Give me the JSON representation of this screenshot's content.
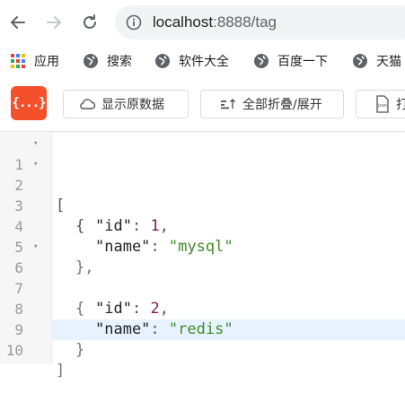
{
  "browser": {
    "url_host": "localhost",
    "url_port": ":8888",
    "url_path": "/tag"
  },
  "bookmarks": [
    {
      "label": "应用",
      "icon": "apps-grid-icon"
    },
    {
      "label": "搜索",
      "icon": "globe-icon"
    },
    {
      "label": "软件大全",
      "icon": "globe-icon"
    },
    {
      "label": "百度一下",
      "icon": "globe-icon"
    },
    {
      "label": "天猫",
      "icon": "globe-icon"
    }
  ],
  "toolbar": {
    "logo_text": "{...}",
    "raw_label": "显示原数据",
    "collapse_label": "全部折叠/展开",
    "print_label": "打"
  },
  "code": {
    "lines": [
      {
        "n": "1",
        "fold": "▾"
      },
      {
        "n": "2",
        "fold": "▾"
      },
      {
        "n": "3",
        "fold": ""
      },
      {
        "n": "4",
        "fold": ""
      },
      {
        "n": "5",
        "fold": ""
      },
      {
        "n": "6",
        "fold": "▾"
      },
      {
        "n": "7",
        "fold": ""
      },
      {
        "n": "8",
        "fold": ""
      },
      {
        "n": "9",
        "fold": ""
      },
      {
        "n": "10",
        "fold": ""
      }
    ],
    "open_array": "[",
    "close_array": "]",
    "open_obj": "{",
    "close_obj": "}",
    "close_obj_comma": "},",
    "key_id": "\"id\"",
    "key_name": "\"name\"",
    "colon": ": ",
    "comma": ",",
    "item1_id": "1",
    "item1_name": "\"mysql\"",
    "item2_id": "2",
    "item2_name": "\"redis\""
  },
  "colors": {
    "logo": "#f4502a",
    "number": "#7b1e58",
    "string": "#3f8c27",
    "active_line": "#e8f2ff"
  }
}
